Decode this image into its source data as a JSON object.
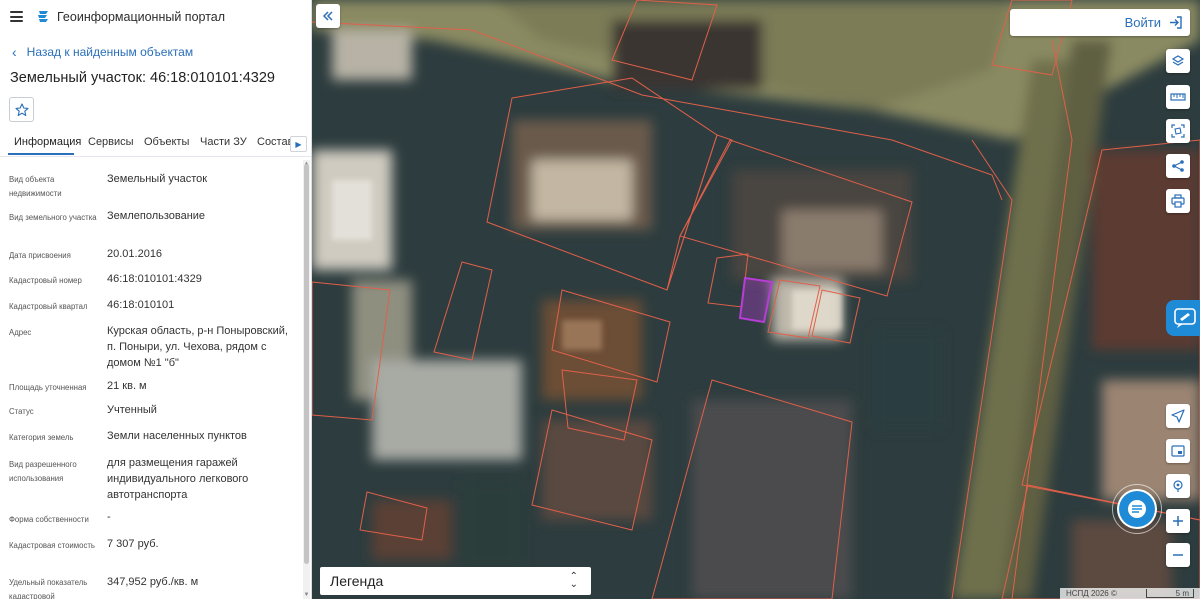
{
  "header": {
    "portal_title": "Геоинформационный портал",
    "menu_icon": "menu-icon",
    "logo_icon": "portal-logo-icon"
  },
  "navigation": {
    "back_label": "Назад к найденным объектам"
  },
  "object": {
    "title": "Земельный участок: 46:18:010101:4329"
  },
  "tabs": [
    {
      "label": "Информация",
      "active": true
    },
    {
      "label": "Сервисы",
      "active": false
    },
    {
      "label": "Объекты",
      "active": false
    },
    {
      "label": "Части ЗУ",
      "active": false
    },
    {
      "label": "Состав",
      "active": false
    }
  ],
  "properties": [
    {
      "label": "Вид объекта недвижимости",
      "value": "Земельный участок"
    },
    {
      "label": "Вид земельного участка",
      "value": "Землепользование"
    },
    {
      "label": "Дата присвоения",
      "value": "20.01.2016"
    },
    {
      "label": "Кадастровый номер",
      "value": "46:18:010101:4329"
    },
    {
      "label": "Кадастровый квартал",
      "value": "46:18:010101"
    },
    {
      "label": "Адрес",
      "value": "Курская область, р-н Поныровский, п. Поныри, ул. Чехова, рядом с домом №1 \"б\""
    },
    {
      "label": "Площадь уточненная",
      "value": "21 кв. м"
    },
    {
      "label": "Статус",
      "value": "Учтенный"
    },
    {
      "label": "Категория земель",
      "value": "Земли населенных пунктов"
    },
    {
      "label": "Вид разрешенного использования",
      "value": "для размещения гаражей индивидуального легкового автотранспорта"
    },
    {
      "label": "Форма собственности",
      "value": "-"
    },
    {
      "label": "Кадастровая стоимость",
      "value": "7 307 руб."
    },
    {
      "label": "Удельный показатель кадастровой",
      "value": "347,952 руб./кв. м"
    }
  ],
  "map": {
    "login_label": "Войти",
    "legend_label": "Легенда",
    "copyright": "НСПД 2026 ©",
    "scale_label": "5 m",
    "accent_color": "#1f8bd6",
    "parcel_color": "#e0604a",
    "selected_color": "#b83cd6",
    "tools_top": [
      "layers-icon",
      "ruler-icon",
      "area-select-icon",
      "share-icon",
      "print-icon"
    ],
    "tools_bottom": [
      "locate-icon",
      "minimap-icon",
      "geo-pin-icon",
      "zoom-in-icon",
      "zoom-out-icon"
    ]
  }
}
